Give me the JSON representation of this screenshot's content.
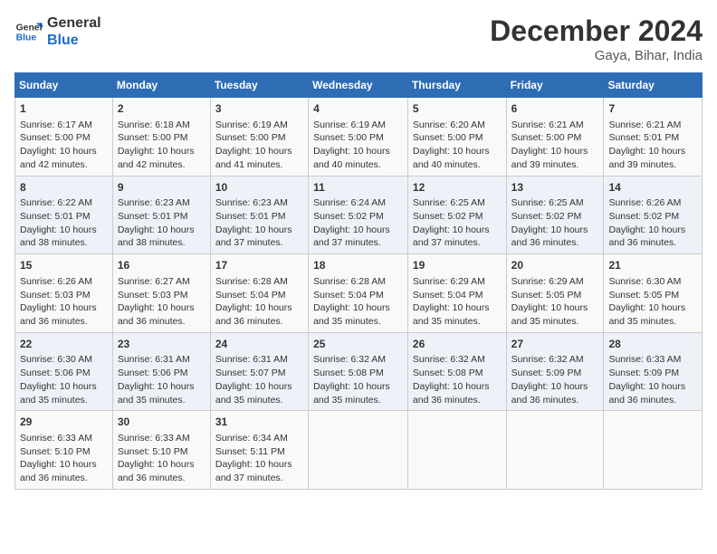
{
  "logo": {
    "line1": "General",
    "line2": "Blue"
  },
  "title": "December 2024",
  "location": "Gaya, Bihar, India",
  "days_of_week": [
    "Sunday",
    "Monday",
    "Tuesday",
    "Wednesday",
    "Thursday",
    "Friday",
    "Saturday"
  ],
  "weeks": [
    [
      {
        "day": "1",
        "sunrise": "6:17 AM",
        "sunset": "5:00 PM",
        "daylight": "10 hours and 42 minutes."
      },
      {
        "day": "2",
        "sunrise": "6:18 AM",
        "sunset": "5:00 PM",
        "daylight": "10 hours and 42 minutes."
      },
      {
        "day": "3",
        "sunrise": "6:19 AM",
        "sunset": "5:00 PM",
        "daylight": "10 hours and 41 minutes."
      },
      {
        "day": "4",
        "sunrise": "6:19 AM",
        "sunset": "5:00 PM",
        "daylight": "10 hours and 40 minutes."
      },
      {
        "day": "5",
        "sunrise": "6:20 AM",
        "sunset": "5:00 PM",
        "daylight": "10 hours and 40 minutes."
      },
      {
        "day": "6",
        "sunrise": "6:21 AM",
        "sunset": "5:00 PM",
        "daylight": "10 hours and 39 minutes."
      },
      {
        "day": "7",
        "sunrise": "6:21 AM",
        "sunset": "5:01 PM",
        "daylight": "10 hours and 39 minutes."
      }
    ],
    [
      {
        "day": "8",
        "sunrise": "6:22 AM",
        "sunset": "5:01 PM",
        "daylight": "10 hours and 38 minutes."
      },
      {
        "day": "9",
        "sunrise": "6:23 AM",
        "sunset": "5:01 PM",
        "daylight": "10 hours and 38 minutes."
      },
      {
        "day": "10",
        "sunrise": "6:23 AM",
        "sunset": "5:01 PM",
        "daylight": "10 hours and 37 minutes."
      },
      {
        "day": "11",
        "sunrise": "6:24 AM",
        "sunset": "5:02 PM",
        "daylight": "10 hours and 37 minutes."
      },
      {
        "day": "12",
        "sunrise": "6:25 AM",
        "sunset": "5:02 PM",
        "daylight": "10 hours and 37 minutes."
      },
      {
        "day": "13",
        "sunrise": "6:25 AM",
        "sunset": "5:02 PM",
        "daylight": "10 hours and 36 minutes."
      },
      {
        "day": "14",
        "sunrise": "6:26 AM",
        "sunset": "5:02 PM",
        "daylight": "10 hours and 36 minutes."
      }
    ],
    [
      {
        "day": "15",
        "sunrise": "6:26 AM",
        "sunset": "5:03 PM",
        "daylight": "10 hours and 36 minutes."
      },
      {
        "day": "16",
        "sunrise": "6:27 AM",
        "sunset": "5:03 PM",
        "daylight": "10 hours and 36 minutes."
      },
      {
        "day": "17",
        "sunrise": "6:28 AM",
        "sunset": "5:04 PM",
        "daylight": "10 hours and 36 minutes."
      },
      {
        "day": "18",
        "sunrise": "6:28 AM",
        "sunset": "5:04 PM",
        "daylight": "10 hours and 35 minutes."
      },
      {
        "day": "19",
        "sunrise": "6:29 AM",
        "sunset": "5:04 PM",
        "daylight": "10 hours and 35 minutes."
      },
      {
        "day": "20",
        "sunrise": "6:29 AM",
        "sunset": "5:05 PM",
        "daylight": "10 hours and 35 minutes."
      },
      {
        "day": "21",
        "sunrise": "6:30 AM",
        "sunset": "5:05 PM",
        "daylight": "10 hours and 35 minutes."
      }
    ],
    [
      {
        "day": "22",
        "sunrise": "6:30 AM",
        "sunset": "5:06 PM",
        "daylight": "10 hours and 35 minutes."
      },
      {
        "day": "23",
        "sunrise": "6:31 AM",
        "sunset": "5:06 PM",
        "daylight": "10 hours and 35 minutes."
      },
      {
        "day": "24",
        "sunrise": "6:31 AM",
        "sunset": "5:07 PM",
        "daylight": "10 hours and 35 minutes."
      },
      {
        "day": "25",
        "sunrise": "6:32 AM",
        "sunset": "5:08 PM",
        "daylight": "10 hours and 35 minutes."
      },
      {
        "day": "26",
        "sunrise": "6:32 AM",
        "sunset": "5:08 PM",
        "daylight": "10 hours and 36 minutes."
      },
      {
        "day": "27",
        "sunrise": "6:32 AM",
        "sunset": "5:09 PM",
        "daylight": "10 hours and 36 minutes."
      },
      {
        "day": "28",
        "sunrise": "6:33 AM",
        "sunset": "5:09 PM",
        "daylight": "10 hours and 36 minutes."
      }
    ],
    [
      {
        "day": "29",
        "sunrise": "6:33 AM",
        "sunset": "5:10 PM",
        "daylight": "10 hours and 36 minutes."
      },
      {
        "day": "30",
        "sunrise": "6:33 AM",
        "sunset": "5:10 PM",
        "daylight": "10 hours and 36 minutes."
      },
      {
        "day": "31",
        "sunrise": "6:34 AM",
        "sunset": "5:11 PM",
        "daylight": "10 hours and 37 minutes."
      },
      {
        "day": "",
        "sunrise": "",
        "sunset": "",
        "daylight": ""
      },
      {
        "day": "",
        "sunrise": "",
        "sunset": "",
        "daylight": ""
      },
      {
        "day": "",
        "sunrise": "",
        "sunset": "",
        "daylight": ""
      },
      {
        "day": "",
        "sunrise": "",
        "sunset": "",
        "daylight": ""
      }
    ]
  ]
}
